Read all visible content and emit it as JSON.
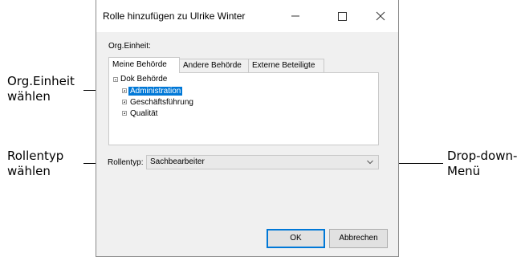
{
  "annotations": {
    "org_unit": [
      "Org.Einheit",
      "wählen"
    ],
    "role_type": [
      "Rollentyp",
      "wählen"
    ],
    "dropdown": [
      "Drop-down-",
      "Menü"
    ]
  },
  "window": {
    "title": "Rolle hinzufügen zu Ulrike Winter",
    "controls": [
      "minimize-icon",
      "maximize-icon",
      "close-icon"
    ]
  },
  "org_unit": {
    "label": "Org.Einheit:",
    "tabs": [
      {
        "label": "Meine Behörde",
        "active": true
      },
      {
        "label": "Andere Behörde",
        "active": false
      },
      {
        "label": "Externe Beteiligte",
        "active": false
      }
    ],
    "tree": {
      "root": "Dok Behörde",
      "children": [
        {
          "label": "Administration",
          "selected": true
        },
        {
          "label": "Geschäftsführung",
          "selected": false
        },
        {
          "label": "Qualität",
          "selected": false
        }
      ]
    }
  },
  "role_type": {
    "label": "Rollentyp:",
    "value": "Sachbearbeiter"
  },
  "buttons": {
    "ok": "OK",
    "cancel": "Abbrechen"
  },
  "colors": {
    "selection": "#0078d7",
    "dialog_bg": "#f0f0f0"
  }
}
